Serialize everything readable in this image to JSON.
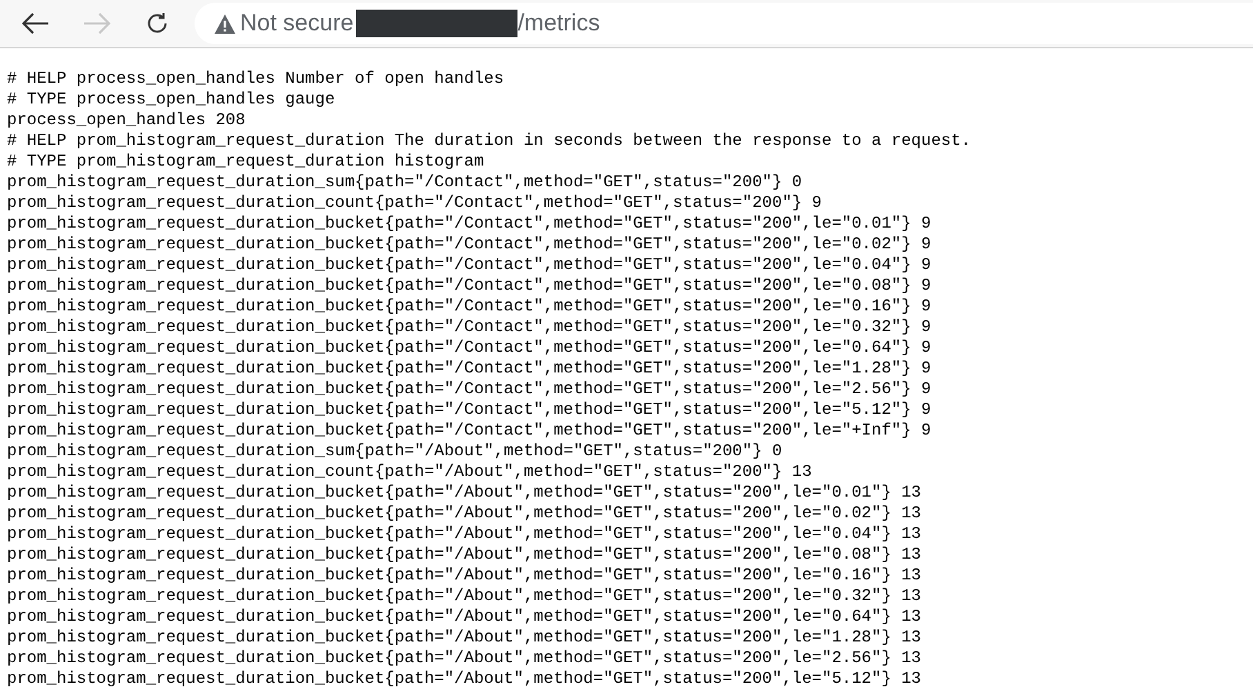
{
  "toolbar": {
    "back_disabled": false,
    "forward_disabled": true,
    "security_label": "Not secure",
    "address_redacted": true,
    "address_path": "/metrics"
  },
  "lines": [
    "# HELP process_open_handles Number of open handles",
    "# TYPE process_open_handles gauge",
    "process_open_handles 208",
    "# HELP prom_histogram_request_duration The duration in seconds between the response to a request.",
    "# TYPE prom_histogram_request_duration histogram",
    "prom_histogram_request_duration_sum{path=\"/Contact\",method=\"GET\",status=\"200\"} 0",
    "prom_histogram_request_duration_count{path=\"/Contact\",method=\"GET\",status=\"200\"} 9",
    "prom_histogram_request_duration_bucket{path=\"/Contact\",method=\"GET\",status=\"200\",le=\"0.01\"} 9",
    "prom_histogram_request_duration_bucket{path=\"/Contact\",method=\"GET\",status=\"200\",le=\"0.02\"} 9",
    "prom_histogram_request_duration_bucket{path=\"/Contact\",method=\"GET\",status=\"200\",le=\"0.04\"} 9",
    "prom_histogram_request_duration_bucket{path=\"/Contact\",method=\"GET\",status=\"200\",le=\"0.08\"} 9",
    "prom_histogram_request_duration_bucket{path=\"/Contact\",method=\"GET\",status=\"200\",le=\"0.16\"} 9",
    "prom_histogram_request_duration_bucket{path=\"/Contact\",method=\"GET\",status=\"200\",le=\"0.32\"} 9",
    "prom_histogram_request_duration_bucket{path=\"/Contact\",method=\"GET\",status=\"200\",le=\"0.64\"} 9",
    "prom_histogram_request_duration_bucket{path=\"/Contact\",method=\"GET\",status=\"200\",le=\"1.28\"} 9",
    "prom_histogram_request_duration_bucket{path=\"/Contact\",method=\"GET\",status=\"200\",le=\"2.56\"} 9",
    "prom_histogram_request_duration_bucket{path=\"/Contact\",method=\"GET\",status=\"200\",le=\"5.12\"} 9",
    "prom_histogram_request_duration_bucket{path=\"/Contact\",method=\"GET\",status=\"200\",le=\"+Inf\"} 9",
    "prom_histogram_request_duration_sum{path=\"/About\",method=\"GET\",status=\"200\"} 0",
    "prom_histogram_request_duration_count{path=\"/About\",method=\"GET\",status=\"200\"} 13",
    "prom_histogram_request_duration_bucket{path=\"/About\",method=\"GET\",status=\"200\",le=\"0.01\"} 13",
    "prom_histogram_request_duration_bucket{path=\"/About\",method=\"GET\",status=\"200\",le=\"0.02\"} 13",
    "prom_histogram_request_duration_bucket{path=\"/About\",method=\"GET\",status=\"200\",le=\"0.04\"} 13",
    "prom_histogram_request_duration_bucket{path=\"/About\",method=\"GET\",status=\"200\",le=\"0.08\"} 13",
    "prom_histogram_request_duration_bucket{path=\"/About\",method=\"GET\",status=\"200\",le=\"0.16\"} 13",
    "prom_histogram_request_duration_bucket{path=\"/About\",method=\"GET\",status=\"200\",le=\"0.32\"} 13",
    "prom_histogram_request_duration_bucket{path=\"/About\",method=\"GET\",status=\"200\",le=\"0.64\"} 13",
    "prom_histogram_request_duration_bucket{path=\"/About\",method=\"GET\",status=\"200\",le=\"1.28\"} 13",
    "prom_histogram_request_duration_bucket{path=\"/About\",method=\"GET\",status=\"200\",le=\"2.56\"} 13",
    "prom_histogram_request_duration_bucket{path=\"/About\",method=\"GET\",status=\"200\",le=\"5.12\"} 13"
  ]
}
